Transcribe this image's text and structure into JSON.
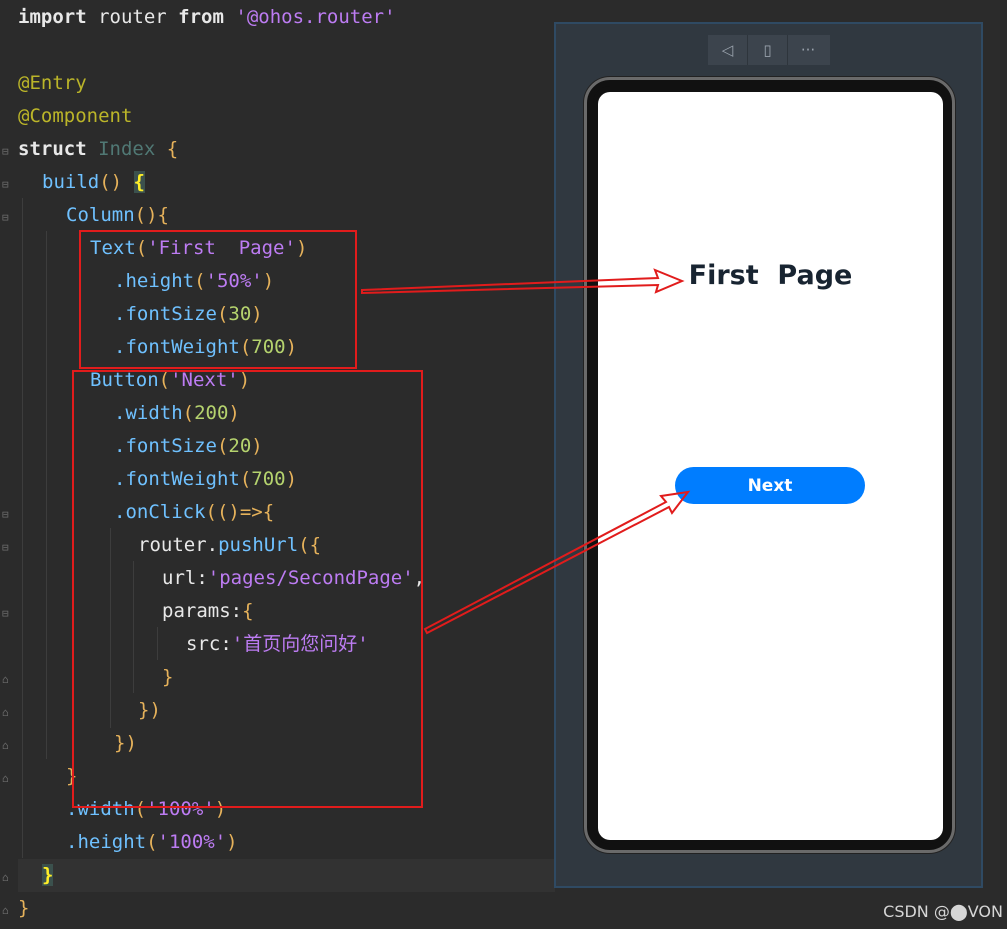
{
  "code": {
    "line1": {
      "kw": "import",
      "a": " router ",
      "kw2": "from",
      "sp": " ",
      "str": "'@ohos.router'"
    },
    "line3": {
      "ann": "@Entry"
    },
    "line4": {
      "ann": "@Component"
    },
    "line5": {
      "kw": "struct",
      "sp": " ",
      "id": "Index",
      "sp2": " ",
      "brace": "{"
    },
    "line6": {
      "fn": "build",
      "paren": "()",
      "sp": " ",
      "brace": "{"
    },
    "line7": {
      "fn": "Column",
      "paren": "(){"
    },
    "line8": {
      "fn": "Text",
      "p1": "(",
      "str": "'First  Page'",
      "p2": ")"
    },
    "line9": {
      "fn": ".height",
      "p1": "(",
      "str": "'50%'",
      "p2": ")"
    },
    "line10": {
      "fn": ".fontSize",
      "p1": "(",
      "num": "30",
      "p2": ")"
    },
    "line11": {
      "fn": ".fontWeight",
      "p1": "(",
      "num": "700",
      "p2": ")"
    },
    "line12": {
      "fn": "Button",
      "p1": "(",
      "str": "'Next'",
      "p2": ")"
    },
    "line13": {
      "fn": ".width",
      "p1": "(",
      "num": "200",
      "p2": ")"
    },
    "line14": {
      "fn": ".fontSize",
      "p1": "(",
      "num": "20",
      "p2": ")"
    },
    "line15": {
      "fn": ".fontWeight",
      "p1": "(",
      "num": "700",
      "p2": ")"
    },
    "line16": {
      "fn": ".onClick",
      "p1": "(()=>{"
    },
    "line17": {
      "obj": "router",
      "dot": ".",
      "fn": "pushUrl",
      "p1": "({"
    },
    "line18": {
      "key": "url:",
      "str": "'pages/SecondPage'",
      "comma": ","
    },
    "line19": {
      "key": "params:",
      "p1": "{"
    },
    "line20": {
      "key": "src:",
      "str": "'首页向您问好'"
    },
    "line21": {
      "p1": "}"
    },
    "line22": {
      "p1": "})"
    },
    "line23": {
      "p1": "})"
    },
    "line24": {
      "p1": "}"
    },
    "line25": {
      "fn": ".width",
      "p1": "(",
      "str": "'100%'",
      "p2": ")"
    },
    "line26": {
      "fn": ".height",
      "p1": "(",
      "str": "'100%'",
      "p2": ")"
    },
    "line27": {
      "p1": "}"
    },
    "line28": {
      "p1": "}"
    }
  },
  "preview": {
    "toolbar": {
      "back_icon": "◁",
      "rotate_icon": "▯",
      "more_icon": "···"
    },
    "app_title": "First  Page",
    "app_button_label": "Next"
  },
  "watermark": "CSDN @⬤VON",
  "colors": {
    "annotation_red": "#e11c1c",
    "button_blue": "#007dff",
    "title_text": "#182431"
  }
}
